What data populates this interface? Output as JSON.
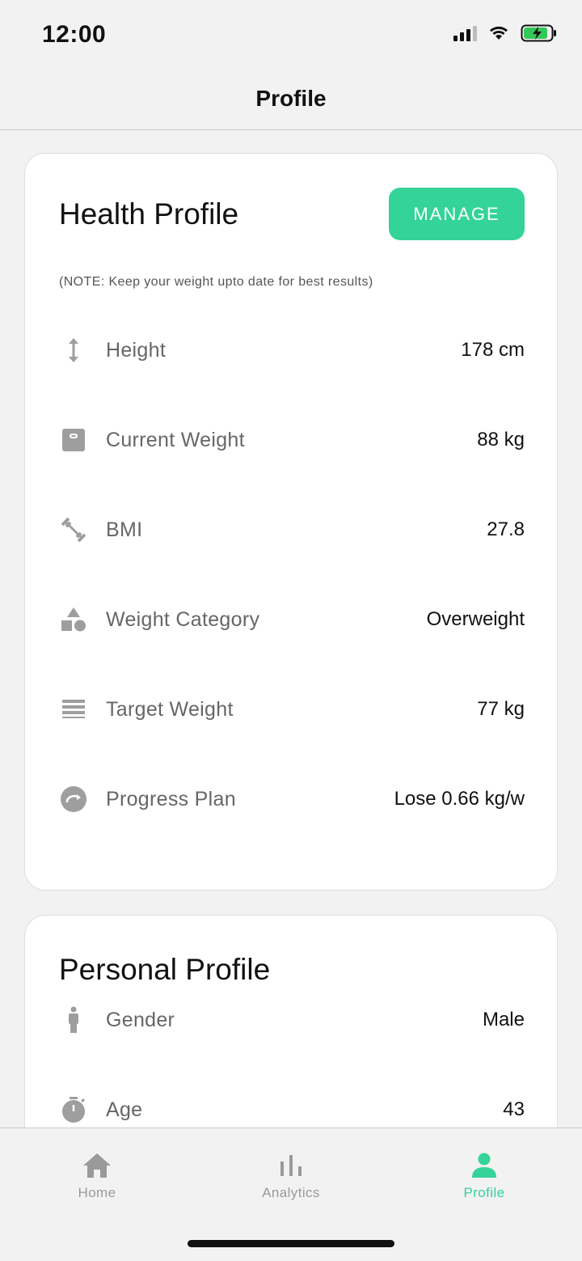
{
  "status_bar": {
    "time": "12:00"
  },
  "nav": {
    "title": "Profile"
  },
  "health_profile": {
    "title": "Health Profile",
    "manage_label": "MANAGE",
    "note": "(NOTE: Keep your weight upto date for best results)",
    "rows": [
      {
        "icon": "height-arrows-icon",
        "label": "Height",
        "value": "178 cm"
      },
      {
        "icon": "scale-icon",
        "label": "Current Weight",
        "value": "88 kg"
      },
      {
        "icon": "dumbbell-icon",
        "label": "BMI",
        "value": "27.8"
      },
      {
        "icon": "shapes-icon",
        "label": "Weight Category",
        "value": "Overweight"
      },
      {
        "icon": "lines-icon",
        "label": "Target Weight",
        "value": "77 kg"
      },
      {
        "icon": "progress-icon",
        "label": "Progress Plan",
        "value": "Lose 0.66 kg/w"
      }
    ]
  },
  "personal_profile": {
    "title": "Personal Profile",
    "rows": [
      {
        "icon": "person-icon",
        "label": "Gender",
        "value": "Male"
      },
      {
        "icon": "stopwatch-icon",
        "label": "Age",
        "value": "43"
      }
    ]
  },
  "tabs": [
    {
      "icon": "home-icon",
      "label": "Home",
      "active": false
    },
    {
      "icon": "analytics-icon",
      "label": "Analytics",
      "active": false
    },
    {
      "icon": "profile-icon",
      "label": "Profile",
      "active": true
    }
  ],
  "colors": {
    "accent": "#34d399",
    "icon_gray": "#9e9e9e"
  }
}
